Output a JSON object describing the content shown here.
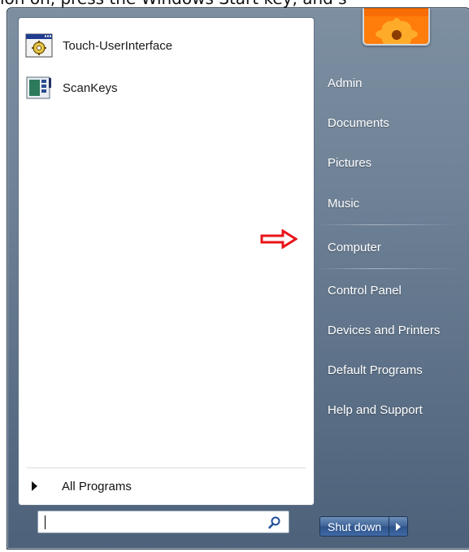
{
  "caption": "ion on, press the Windows Start key, and s",
  "pinned": [
    {
      "label": "Touch-UserInterface",
      "icon": "gear-app-icon"
    },
    {
      "label": "ScanKeys",
      "icon": "scankeys-app-icon"
    }
  ],
  "all_programs": {
    "label": "All Programs"
  },
  "search": {
    "value": "",
    "placeholder": ""
  },
  "right_menu": [
    {
      "label": "Admin"
    },
    {
      "label": "Documents"
    },
    {
      "label": "Pictures"
    },
    {
      "label": "Music"
    },
    {
      "label": "Computer"
    },
    {
      "label": "Control Panel"
    },
    {
      "label": "Devices and Printers"
    },
    {
      "label": "Default Programs"
    },
    {
      "label": "Help and Support"
    }
  ],
  "shutdown": {
    "label": "Shut down"
  },
  "colors": {
    "accent_arrow": "#e8141a",
    "panel_bg": "#ffffff",
    "menu_bg": "#6e8196"
  }
}
